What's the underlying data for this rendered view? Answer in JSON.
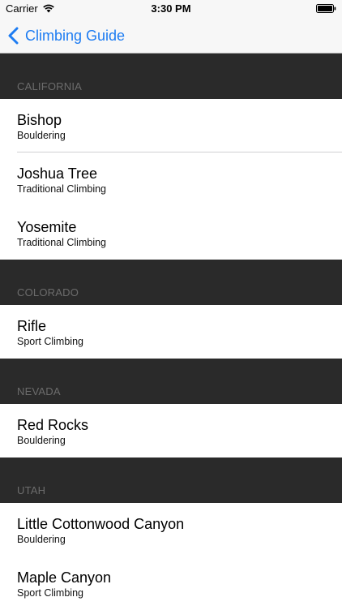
{
  "status_bar": {
    "carrier": "Carrier",
    "time": "3:30 PM"
  },
  "nav": {
    "back_label": "Climbing Guide",
    "accent_color": "#1d7cf2"
  },
  "sections": [
    {
      "header": "CALIFORNIA",
      "rows": [
        {
          "title": "Bishop",
          "subtitle": "Bouldering"
        },
        {
          "title": "Joshua Tree",
          "subtitle": "Traditional Climbing"
        },
        {
          "title": "Yosemite",
          "subtitle": "Traditional Climbing"
        }
      ]
    },
    {
      "header": "COLORADO",
      "rows": [
        {
          "title": "Rifle",
          "subtitle": "Sport Climbing"
        }
      ]
    },
    {
      "header": "NEVADA",
      "rows": [
        {
          "title": "Red Rocks",
          "subtitle": "Bouldering"
        }
      ]
    },
    {
      "header": "UTAH",
      "rows": [
        {
          "title": "Little Cottonwood Canyon",
          "subtitle": "Bouldering"
        },
        {
          "title": "Maple Canyon",
          "subtitle": "Sport Climbing"
        }
      ]
    }
  ]
}
